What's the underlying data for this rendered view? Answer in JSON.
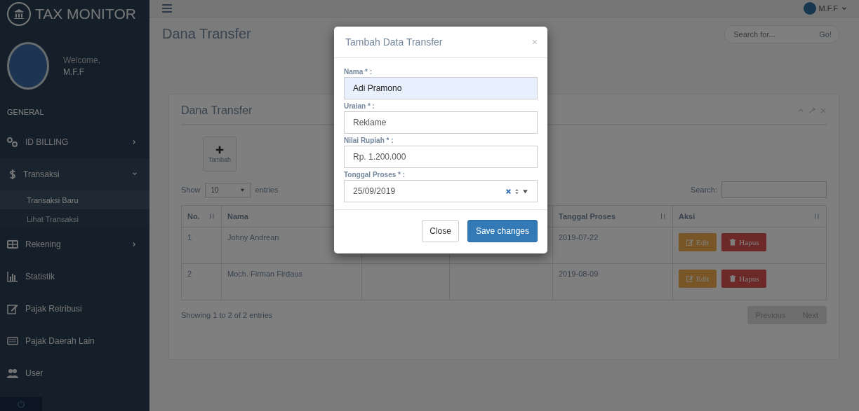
{
  "brand": {
    "title": "TAX MONITOR"
  },
  "profile": {
    "greeting": "Welcome,",
    "name": "M.F.F"
  },
  "sidebar": {
    "section": "GENERAL",
    "items": [
      {
        "label": "ID BILLING",
        "expanded": false,
        "active": false
      },
      {
        "label": "Transaksi",
        "expanded": true,
        "active": true,
        "children": [
          {
            "label": "Transaksi Baru",
            "selected": true
          },
          {
            "label": "Lihat Transaksi",
            "selected": false
          }
        ]
      },
      {
        "label": "Rekening",
        "expanded": false,
        "active": false
      },
      {
        "label": "Statistik",
        "active": false
      },
      {
        "label": "Pajak Retribusi",
        "active": false
      },
      {
        "label": "Pajak Daerah Lain",
        "active": false
      },
      {
        "label": "User",
        "active": false
      }
    ]
  },
  "top_nav": {
    "user": "M.F.F"
  },
  "page": {
    "title": "Dana Transfer",
    "search": {
      "placeholder": "Search for...",
      "button": "Go!"
    }
  },
  "panel": {
    "title": "Dana Transfer",
    "add_button": "Tambah",
    "length": {
      "before": "Show",
      "value": "10",
      "after": "entries"
    },
    "search_label": "Search:",
    "table": {
      "columns": [
        "No.",
        "Nama",
        "Tanggal Proses",
        "Aksi"
      ],
      "rows": [
        {
          "no": "1",
          "nama": "Johny Andrean",
          "tanggal_proses": "2019-07-22",
          "actions": [
            {
              "kind": "edit",
              "label": "Edit"
            },
            {
              "kind": "delete",
              "label": "Hapus"
            }
          ]
        },
        {
          "no": "2",
          "nama": "Moch. Firman Firdaus",
          "tanggal_proses": "2019-08-09",
          "actions": [
            {
              "kind": "edit",
              "label": "Edit"
            },
            {
              "kind": "delete",
              "label": "Hapus"
            }
          ]
        }
      ]
    },
    "info": "Showing 1 to 2 of 2 entries",
    "pagination": [
      "Previous",
      "Next"
    ]
  },
  "modal": {
    "title": "Tambah Data Transfer",
    "close": "×",
    "fields": [
      {
        "kind": "text",
        "label": "Nama * :",
        "value": "Adi Pramono",
        "autofilled": true
      },
      {
        "kind": "text",
        "label": "Uraian * :",
        "value": "Reklame",
        "autofilled": false
      },
      {
        "kind": "text",
        "label": "Nilai Rupiah * :",
        "value": "Rp. 1.200.000",
        "autofilled": false
      },
      {
        "kind": "date",
        "label": "Tonggal Proses * :",
        "value": "25/09/2019",
        "autofilled": false
      }
    ],
    "buttons": [
      {
        "kind": "default",
        "label": "Close"
      },
      {
        "kind": "primary",
        "label": "Save changes"
      }
    ]
  }
}
